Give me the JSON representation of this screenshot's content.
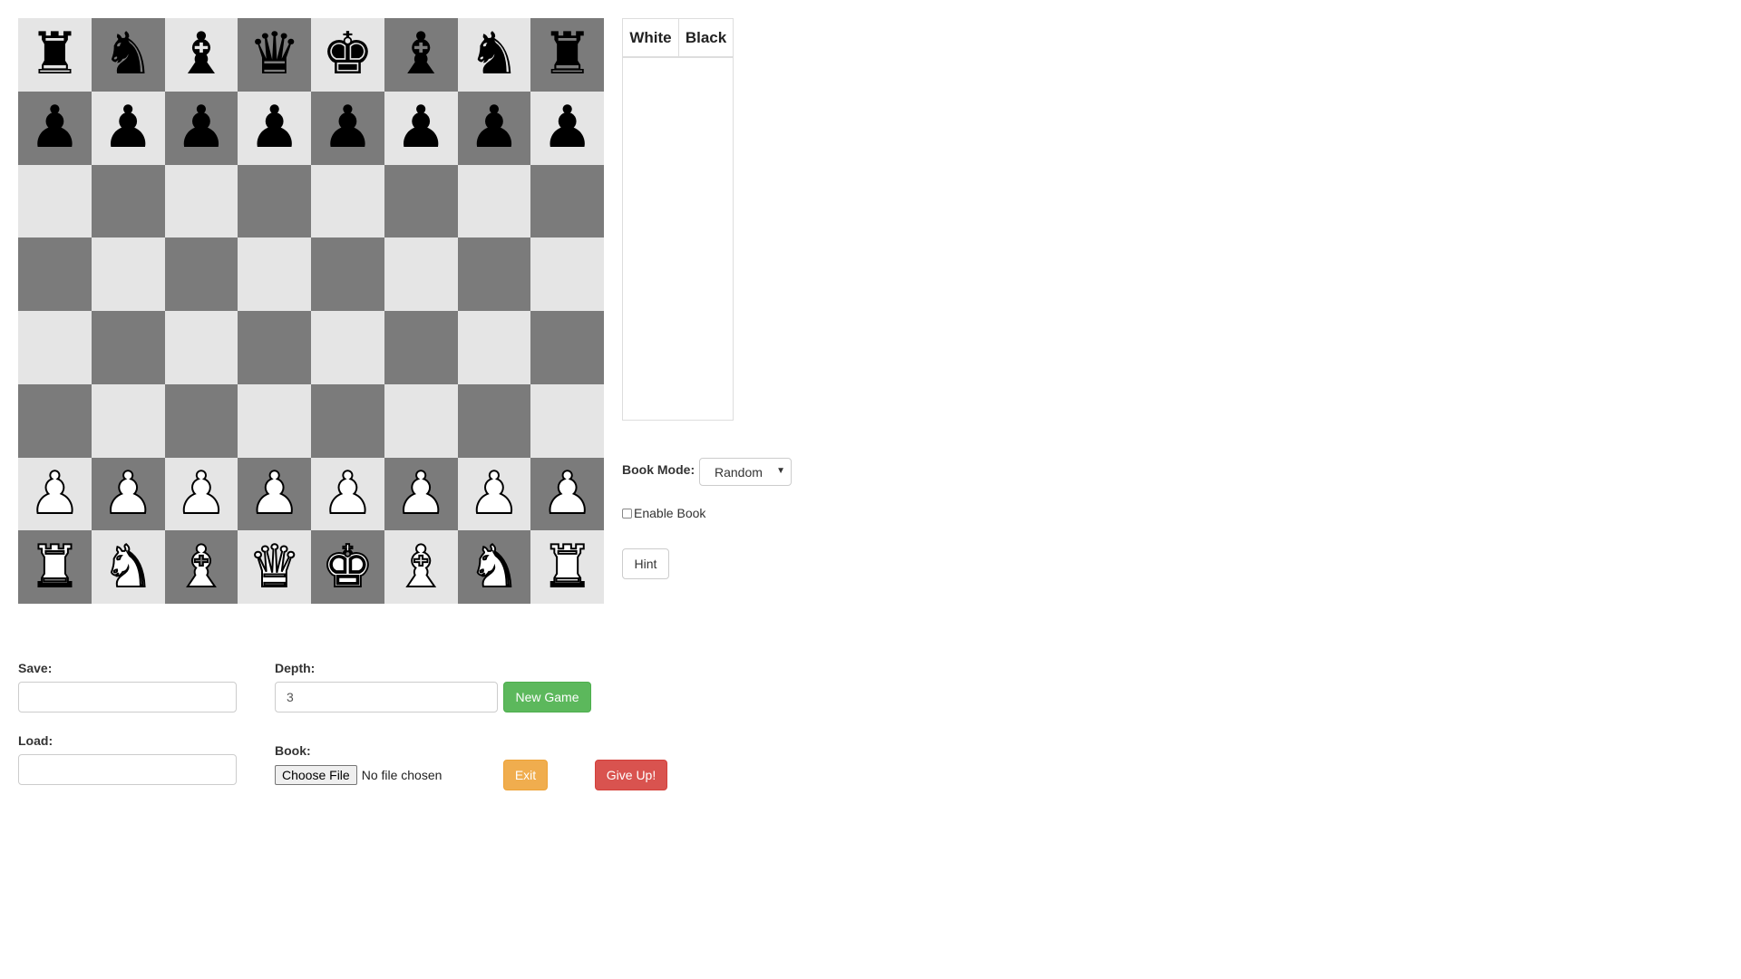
{
  "board": {
    "squares": [
      [
        "♜",
        "♞",
        "♝",
        "♛",
        "♚",
        "♝",
        "♞",
        "♜"
      ],
      [
        "♟",
        "♟",
        "♟",
        "♟",
        "♟",
        "♟",
        "♟",
        "♟"
      ],
      [
        "",
        "",
        "",
        "",
        "",
        "",
        "",
        ""
      ],
      [
        "",
        "",
        "",
        "",
        "",
        "",
        "",
        ""
      ],
      [
        "",
        "",
        "",
        "",
        "",
        "",
        "",
        ""
      ],
      [
        "",
        "",
        "",
        "",
        "",
        "",
        "",
        ""
      ],
      [
        "♟",
        "♟",
        "♟",
        "♟",
        "♟",
        "♟",
        "♟",
        "♟"
      ],
      [
        "♜",
        "♞",
        "♝",
        "♛",
        "♚",
        "♝",
        "♞",
        "♜"
      ]
    ],
    "piece_colors": [
      [
        "black",
        "black",
        "black",
        "black",
        "black",
        "black",
        "black",
        "black"
      ],
      [
        "black",
        "black",
        "black",
        "black",
        "black",
        "black",
        "black",
        "black"
      ],
      [
        "",
        "",
        "",
        "",
        "",
        "",
        "",
        ""
      ],
      [
        "",
        "",
        "",
        "",
        "",
        "",
        "",
        ""
      ],
      [
        "",
        "",
        "",
        "",
        "",
        "",
        "",
        ""
      ],
      [
        "",
        "",
        "",
        "",
        "",
        "",
        "",
        ""
      ],
      [
        "white",
        "white",
        "white",
        "white",
        "white",
        "white",
        "white",
        "white"
      ],
      [
        "white",
        "white",
        "white",
        "white",
        "white",
        "white",
        "white",
        "white"
      ]
    ],
    "light_color": "#e5e5e5",
    "dark_color": "#7b7b7b"
  },
  "moves": {
    "white_header": "White",
    "black_header": "Black",
    "entries": []
  },
  "book_mode": {
    "label": "Book Mode:",
    "selected": "Random"
  },
  "enable_book": {
    "label": "Enable Book",
    "checked": false
  },
  "hint_label": "Hint",
  "save": {
    "label": "Save:",
    "value": ""
  },
  "load": {
    "label": "Load:",
    "value": ""
  },
  "depth": {
    "label": "Depth:",
    "value": "3"
  },
  "book": {
    "label": "Book:",
    "button_label": "Choose File",
    "status": "No file chosen"
  },
  "new_game_label": "New Game",
  "exit_label": "Exit",
  "give_up_label": "Give Up!",
  "colors": {
    "success": "#5cb85c",
    "warning": "#f0ad4e",
    "danger": "#d9534f"
  }
}
